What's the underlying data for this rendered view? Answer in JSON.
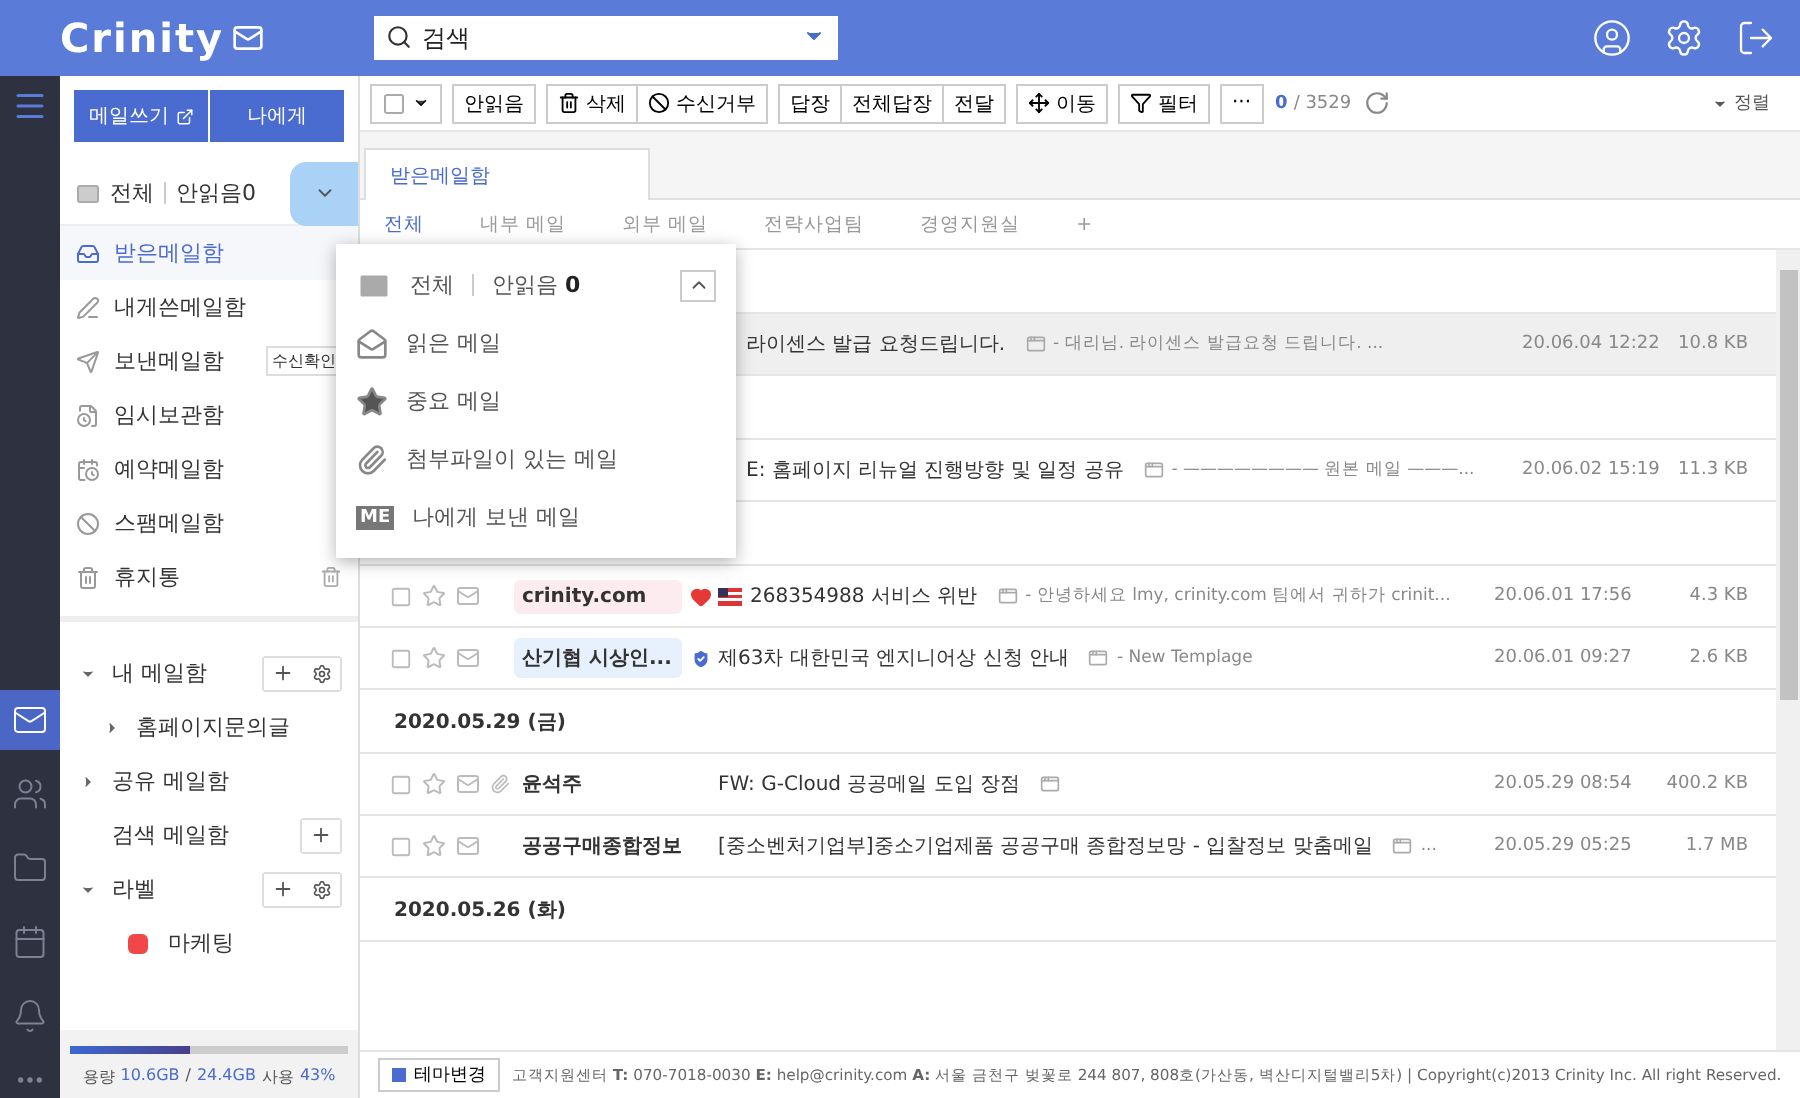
{
  "header": {
    "logo": "Crinity",
    "search": {
      "placeholder": "검색"
    }
  },
  "rail": [
    {
      "selected": true
    },
    {
      "selected": false
    },
    {
      "selected": false
    },
    {
      "selected": false
    },
    {
      "selected": false
    }
  ],
  "sidebar": {
    "compose": "메일쓰기",
    "to_me": "나에게",
    "filter": {
      "all": "전체",
      "unread": "안읽음0",
      "open": true
    },
    "folders": [
      {
        "label": "받은메일함",
        "selected": true
      },
      {
        "label": "내게쓴메일함",
        "selected": false
      },
      {
        "label": "보낸메일함",
        "selected": false,
        "badge": "수신확인"
      },
      {
        "label": "임시보관함",
        "selected": false
      },
      {
        "label": "예약메일함",
        "selected": false
      },
      {
        "label": "스팸메일함",
        "selected": false
      },
      {
        "label": "휴지통",
        "selected": false,
        "trash": true
      }
    ],
    "tree": [
      {
        "label": "내 메일함",
        "expanded": true,
        "add": true,
        "settings": true,
        "children": [
          {
            "label": "홈페이지문의글",
            "expanded": false
          }
        ]
      },
      {
        "label": "공유 메일함",
        "expanded": false
      },
      {
        "label": "검색 메일함",
        "add": true
      },
      {
        "label": "라벨",
        "expanded": true,
        "add": true,
        "settings": true,
        "children": [
          {
            "label": "마케팅",
            "color": "#f04848"
          }
        ]
      }
    ],
    "storage": {
      "label": "용량",
      "used": "10.6GB",
      "separator": "/",
      "total": "24.4GB",
      "used_label": "사용",
      "percent": "43%",
      "level": 0.43
    }
  },
  "toolbar": {
    "select_all": {
      "checked": false
    },
    "groups": [
      [
        "안읽음"
      ],
      [
        "삭제",
        "수신거부"
      ],
      [
        "답장",
        "전체답장",
        "전달"
      ],
      [
        "이동"
      ],
      [
        "필터"
      ],
      [
        "···"
      ]
    ],
    "count": "0",
    "total": "/ 3529",
    "sort": "정렬"
  },
  "tab": "받은메일함",
  "subtabs": [
    {
      "label": "전체",
      "selected": true
    },
    {
      "label": "내부 메일",
      "selected": false
    },
    {
      "label": "외부 메일",
      "selected": false
    },
    {
      "label": "전략사업팀",
      "selected": false
    },
    {
      "label": "경영지원실",
      "selected": false
    },
    {
      "label": "+",
      "selected": false
    }
  ],
  "rows": [
    {
      "kind": "date",
      "covered": true
    },
    {
      "kind": "mail",
      "covered": true,
      "highlighted": true,
      "subject": "라이센스 발급 요청드립니다.",
      "preview": "- 대리님. 라이센스 발급요청 드립니다. ...",
      "date": "20.06.04 12:22",
      "size": "10.8 KB"
    },
    {
      "kind": "date",
      "covered": true
    },
    {
      "kind": "mail",
      "covered": true,
      "highlighted": false,
      "subject": "E: 홈페이지 리뉴얼 진행방향 및 일정 공유",
      "preview": "- ———————— 원본 메일 ———...",
      "date": "20.06.02 15:19",
      "size": "11.3 KB"
    },
    {
      "kind": "date",
      "covered": true
    },
    {
      "kind": "mail",
      "covered": false,
      "highlighted": false,
      "sender": "crinity.com",
      "color": "#fdecef",
      "spam_warning": true,
      "country_flag": true,
      "subject": "268354988 서비스 위반",
      "preview": "- 안녕하세요 lmy, crinity.com 팀에서 귀하가 crinit...",
      "date": "20.06.01 17:56",
      "size": "4.3 KB"
    },
    {
      "kind": "mail",
      "covered": false,
      "highlighted": false,
      "sender": "산기협 시상인...",
      "color": "#e6f1fd",
      "verified": true,
      "subject": "제63차 대한민국 엔지니어상 신청 안내",
      "preview": "- New Templage",
      "date": "20.06.01 09:27",
      "size": "2.6 KB"
    },
    {
      "kind": "date",
      "covered": false,
      "label": "2020.05.29 (금)"
    },
    {
      "kind": "mail",
      "covered": false,
      "highlighted": false,
      "sender": "윤석주",
      "attachment": true,
      "subject": "FW: G-Cloud 공공메일 도입 장점",
      "date": "20.05.29 08:54",
      "size": "400.2 KB"
    },
    {
      "kind": "mail",
      "covered": false,
      "highlighted": false,
      "sender": "공공구매종합정보",
      "subject": "[중소벤처기업부]중소기업제품 공공구매 종합정보망 - 입찰정보 맞춤메일",
      "preview": "...",
      "date": "20.05.29 05:25",
      "size": "1.7 MB"
    },
    {
      "kind": "date",
      "covered": false,
      "label": "2020.05.26 (화)"
    }
  ],
  "dropdown": {
    "all": "전체",
    "unread": "안읽음",
    "unread_count": "0",
    "items": [
      {
        "kind": "read",
        "label": "읽은 메일"
      },
      {
        "kind": "important",
        "label": "중요 메일"
      },
      {
        "kind": "attachment",
        "label": "첨부파일이 있는 메일"
      },
      {
        "kind": "me",
        "badge": "ME",
        "label": "나에게 보낸 메일"
      }
    ]
  },
  "footer": {
    "theme": "테마변경",
    "info": "고객지원센터 **T:** 070-7018-0030 **E:** help@crinity.com **A:** 서울 금천구 벚꽃로 244 807, 808호(가산동, 벽산디지털밸리5차) | Copyright(c)2013 Crinity Inc. All right Reserved."
  }
}
